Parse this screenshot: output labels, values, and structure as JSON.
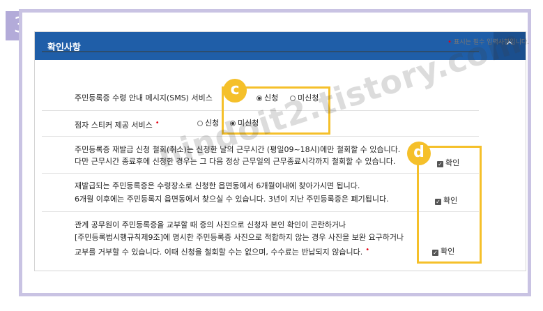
{
  "step_number": "3",
  "panel": {
    "title": "확인사항",
    "collapse_glyph": "^",
    "collapse_icon": "chevron-up-icon"
  },
  "required_note": "표시는 필수 입력사항입니다.",
  "rows": {
    "sms": {
      "label": "주민등록증 수령 안내 메시지(SMS) 서비스",
      "options": [
        "신청",
        "미신청"
      ],
      "selected": "신청"
    },
    "braille": {
      "label": "점자 스티커 제공 서비스",
      "options": [
        "신청",
        "미신청"
      ],
      "selected": "미신청"
    },
    "reissue_cancel": {
      "line1": "주민등록증 재발급 신청 철회(취소)는 신청한 날의 근무시간 (평일09~18시)에만 철회할 수 있습니다.",
      "line2": "다만 근무시간 종료후에 신청한 경우는 그 다음 정상 근무일의 근무종료시각까지 철회할 수 있습니다.",
      "confirm_label": "확인",
      "checked": true
    },
    "pickup": {
      "line1": "재발급되는 주민등록증은 수령장소로 신청한 읍면동에서 6개월이내에 찾아가시면 됩니다.",
      "line2": "6개월 이후에는 주민등록지 읍면동에서 찾으실 수 있습니다. 3년이 지난 주민등록증은 폐기됩니다.",
      "confirm_label": "확인",
      "checked": true
    },
    "photo": {
      "line1": "관계 공무원이 주민등록증을 교부할 때 증의 사진으로 신청자 본인 확인이 곤란하거나",
      "line2": "[주민등록법시행규칙제9조]에 명시한 주민등록증 사진으로 적합하지 않는 경우 사진을 보완 요구하거나",
      "line3": "교부를 거부할 수 있습니다. 이때 신청을 철회할 수는 없으며, 수수료는 반납되지 않습니다.",
      "confirm_label": "확인",
      "checked": true
    }
  },
  "annotations": {
    "c": "c",
    "d": "d"
  },
  "watermark": "nindoit2.tistory.com",
  "colors": {
    "header": "#1f5ea8",
    "frame": "#c9c3e3",
    "highlight": "#f5c02a",
    "required": "#e60012"
  }
}
